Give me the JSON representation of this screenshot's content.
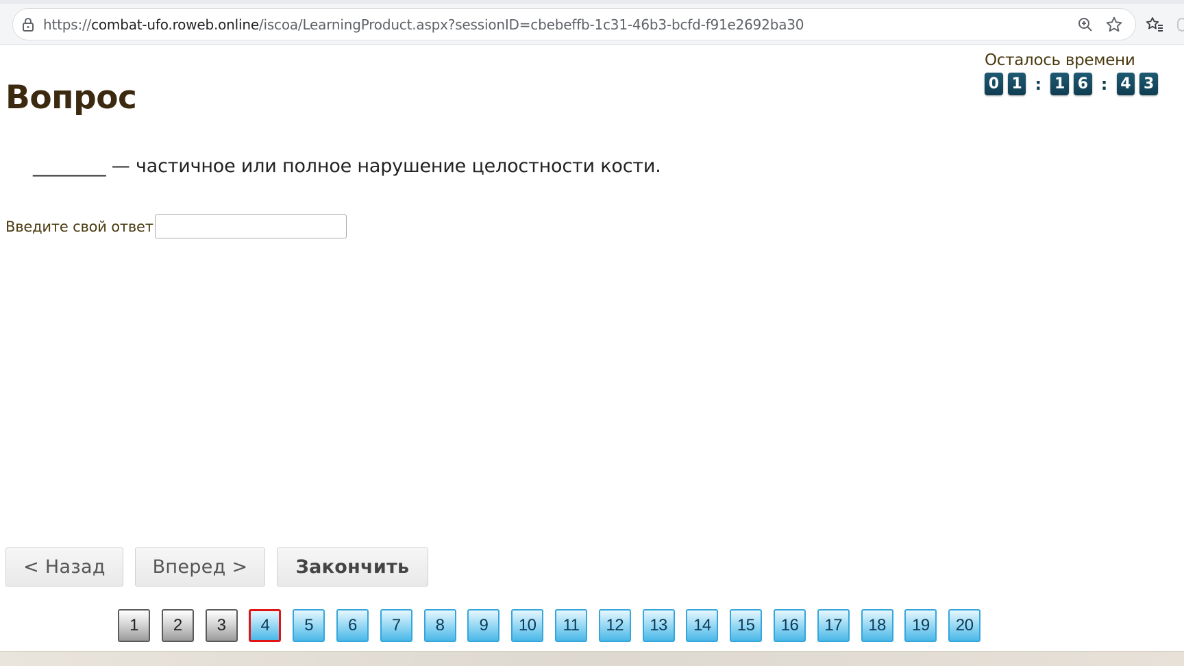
{
  "browser": {
    "url_scheme": "https://",
    "url_host": "combat-ufo.roweb.online",
    "url_path": "/iscoa/LearningProduct.aspx?sessionID=cbebeffb-1c31-46b3-bcfd-f91e2692ba30",
    "icons": [
      "lock-icon",
      "zoom-icon",
      "star-icon",
      "favorites-icon"
    ]
  },
  "page": {
    "title": "Вопрос",
    "timer": {
      "label": "Осталось времени",
      "digits": [
        "0",
        "1",
        "1",
        "6",
        "4",
        "3"
      ],
      "separator": ":"
    },
    "question_text": "________ — частичное или полное нарушение целостности кости.",
    "answer": {
      "label": "Введите свой ответ",
      "value": "",
      "placeholder": ""
    },
    "nav": {
      "back_label": "< Назад",
      "forward_label": "Вперед >",
      "finish_label": "Закончить"
    },
    "questions": [
      {
        "n": "1",
        "state": "done"
      },
      {
        "n": "2",
        "state": "done"
      },
      {
        "n": "3",
        "state": "done"
      },
      {
        "n": "4",
        "state": "current"
      },
      {
        "n": "5",
        "state": "todo"
      },
      {
        "n": "6",
        "state": "todo"
      },
      {
        "n": "7",
        "state": "todo"
      },
      {
        "n": "8",
        "state": "todo"
      },
      {
        "n": "9",
        "state": "todo"
      },
      {
        "n": "10",
        "state": "todo"
      },
      {
        "n": "11",
        "state": "todo"
      },
      {
        "n": "12",
        "state": "todo"
      },
      {
        "n": "13",
        "state": "todo"
      },
      {
        "n": "14",
        "state": "todo"
      },
      {
        "n": "15",
        "state": "todo"
      },
      {
        "n": "16",
        "state": "todo"
      },
      {
        "n": "17",
        "state": "todo"
      },
      {
        "n": "18",
        "state": "todo"
      },
      {
        "n": "19",
        "state": "todo"
      },
      {
        "n": "20",
        "state": "todo"
      }
    ]
  },
  "colors": {
    "title": "#3b2a0f",
    "timer_digit_bg": "#0f3d52",
    "current_question_border": "#e01515",
    "todo_question": "#4bb8e8"
  }
}
